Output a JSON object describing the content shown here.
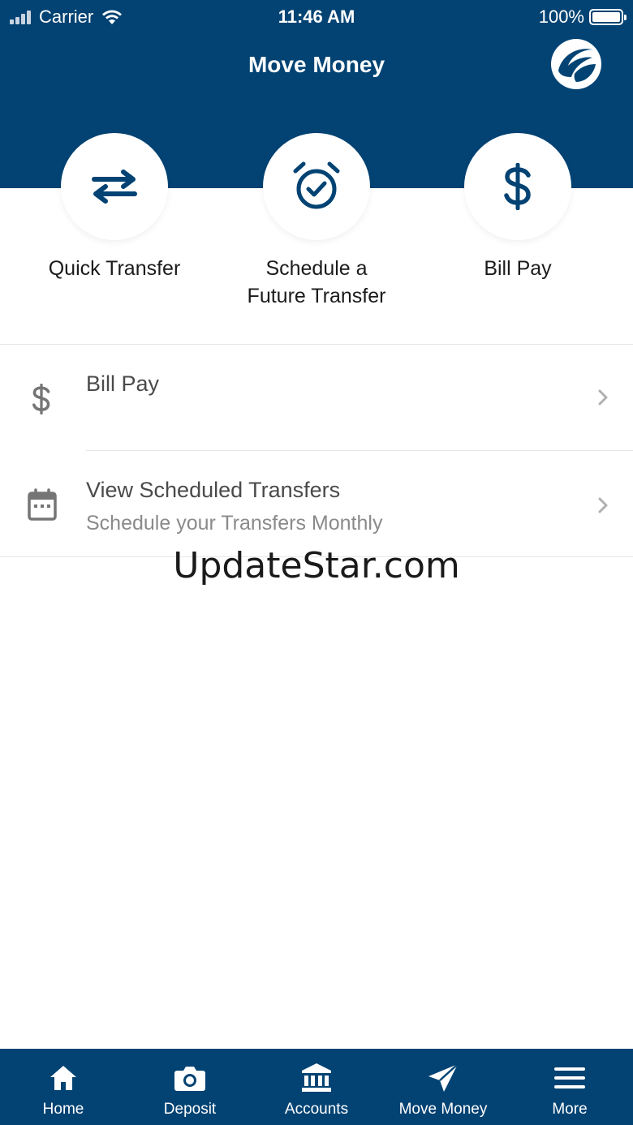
{
  "status_bar": {
    "carrier": "Carrier",
    "time": "11:46 AM",
    "battery_percent": "100%"
  },
  "header": {
    "title": "Move Money",
    "background_color": "#024373",
    "logo_icon": "brand-logo-icon"
  },
  "quick_actions": [
    {
      "label": "Quick Transfer",
      "icon": "swap-arrows-icon"
    },
    {
      "label": "Schedule a Future Transfer",
      "icon": "alarm-clock-check-icon"
    },
    {
      "label": "Bill Pay",
      "icon": "dollar-icon"
    }
  ],
  "list": [
    {
      "title": "Bill Pay",
      "subtitle": "",
      "icon": "dollar-icon"
    },
    {
      "title": "View Scheduled Transfers",
      "subtitle": "Schedule your Transfers Monthly",
      "icon": "calendar-icon"
    }
  ],
  "watermark": "UpdateStar.com",
  "tab_bar": {
    "active_index": 3,
    "items": [
      {
        "label": "Home",
        "icon": "home-icon"
      },
      {
        "label": "Deposit",
        "icon": "camera-icon"
      },
      {
        "label": "Accounts",
        "icon": "bank-icon"
      },
      {
        "label": "Move Money",
        "icon": "paper-plane-icon"
      },
      {
        "label": "More",
        "icon": "menu-icon"
      }
    ]
  }
}
